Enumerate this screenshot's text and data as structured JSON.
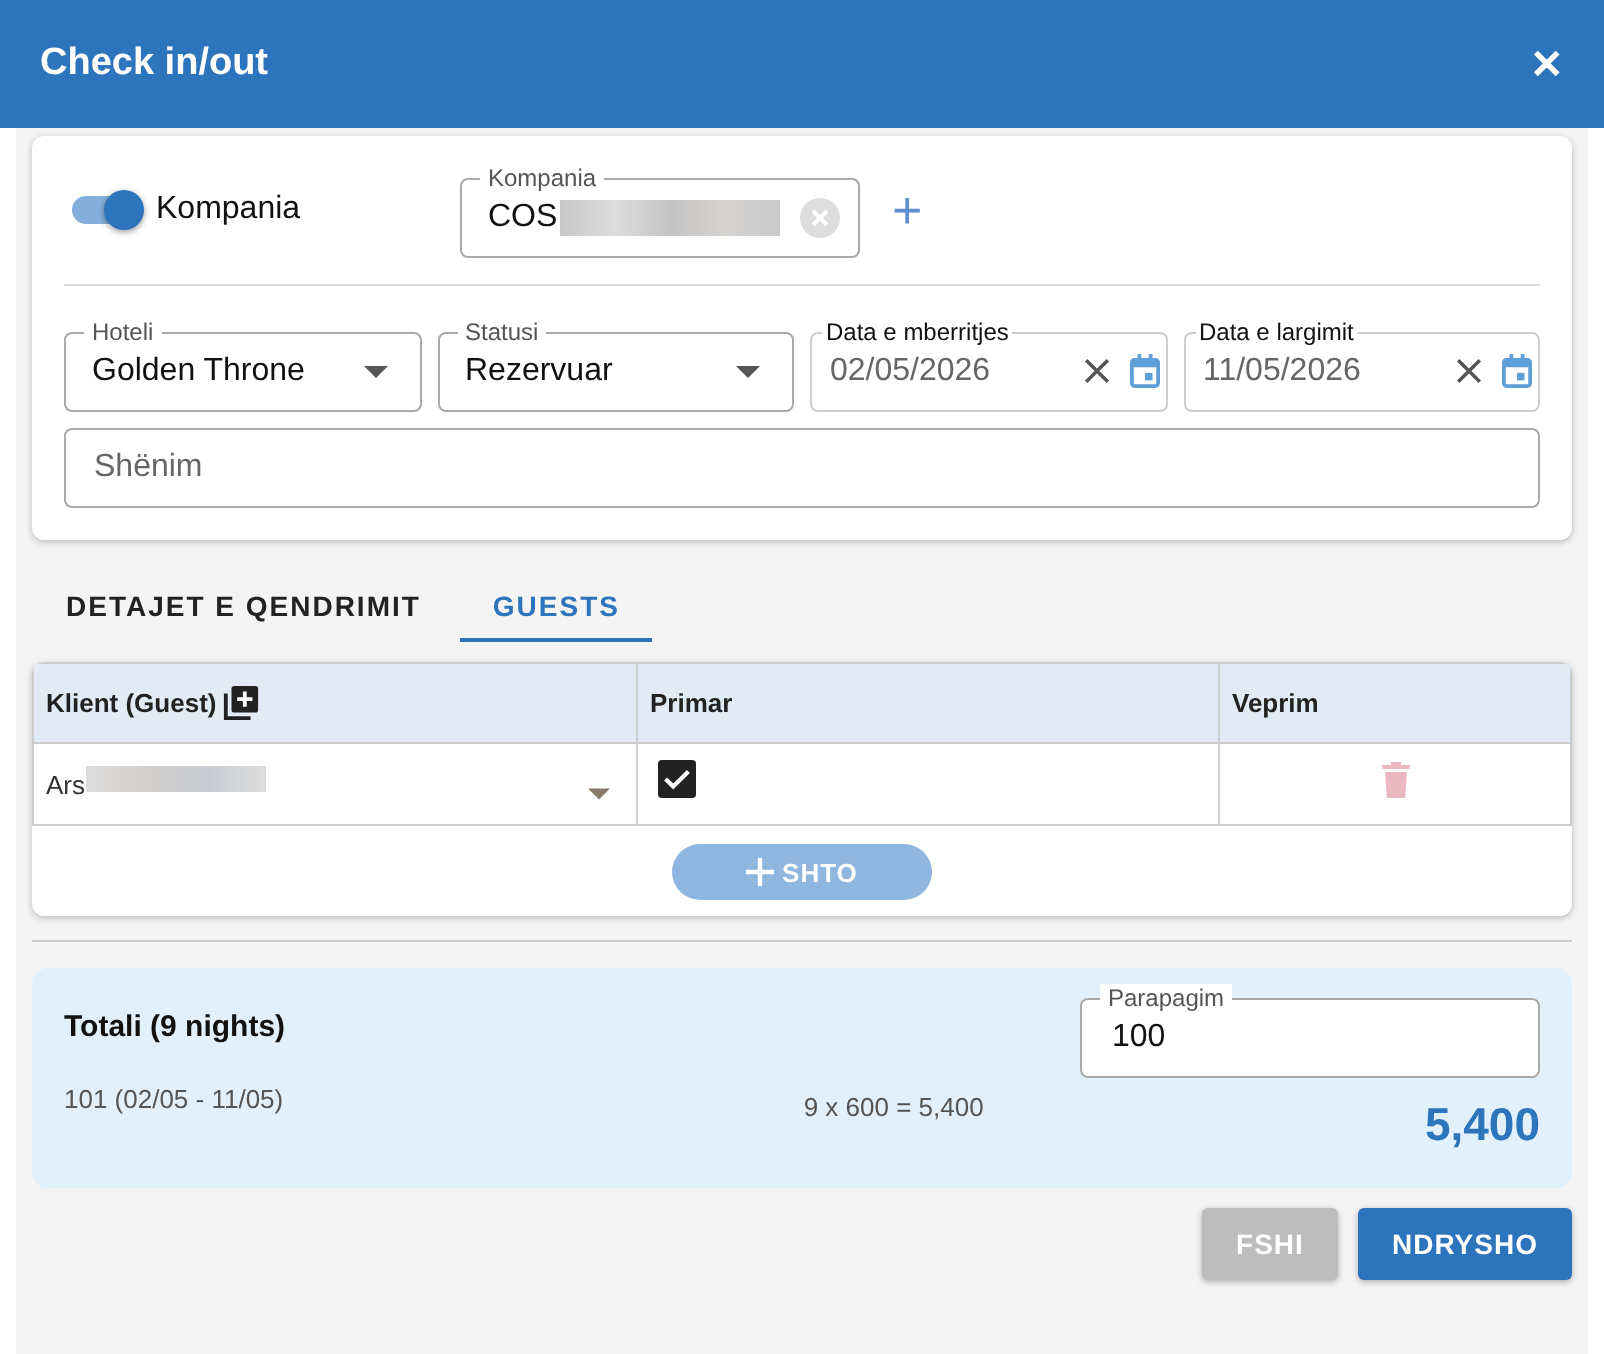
{
  "window": {
    "title": "Check in/out",
    "close": "✕"
  },
  "company": {
    "toggle_label": "Kompania",
    "on": true,
    "field_label": "Kompania",
    "value": "COS",
    "add": "+"
  },
  "fields": [
    {
      "label": "Hoteli",
      "value": "Golden Throne",
      "kind": "select",
      "disabled": false
    },
    {
      "label": "Statusi",
      "value": "Rezervuar",
      "kind": "select",
      "disabled": false
    },
    {
      "label": "Data e mberritjes",
      "value": "02/05/2026",
      "kind": "date",
      "disabled": true
    },
    {
      "label": "Data e largimit",
      "value": "11/05/2026",
      "kind": "date",
      "disabled": true
    }
  ],
  "note": {
    "placeholder": "Shënim"
  },
  "tabs": [
    {
      "label": "DETAJET E QENDRIMIT",
      "selected": false
    },
    {
      "label": "GUESTS",
      "selected": true
    }
  ],
  "guests_table": {
    "columns": [
      "Klient (Guest)",
      "Primar",
      "Veprim"
    ],
    "rows": [
      {
        "guest": "Ars",
        "primary": true
      }
    ],
    "add_button": {
      "label": "SHTO",
      "disabled": true
    }
  },
  "summary": {
    "title": "Totali (9 nights)",
    "room": "101 (02/05 - 11/05)",
    "calc": "9 x 600 = 5,400",
    "total": "5,400",
    "prepay_label": "Parapagim",
    "prepay_value": "100"
  },
  "buttons": [
    {
      "label": "FSHI",
      "disabled": true
    },
    {
      "label": "NDRYSHO",
      "disabled": false
    }
  ]
}
